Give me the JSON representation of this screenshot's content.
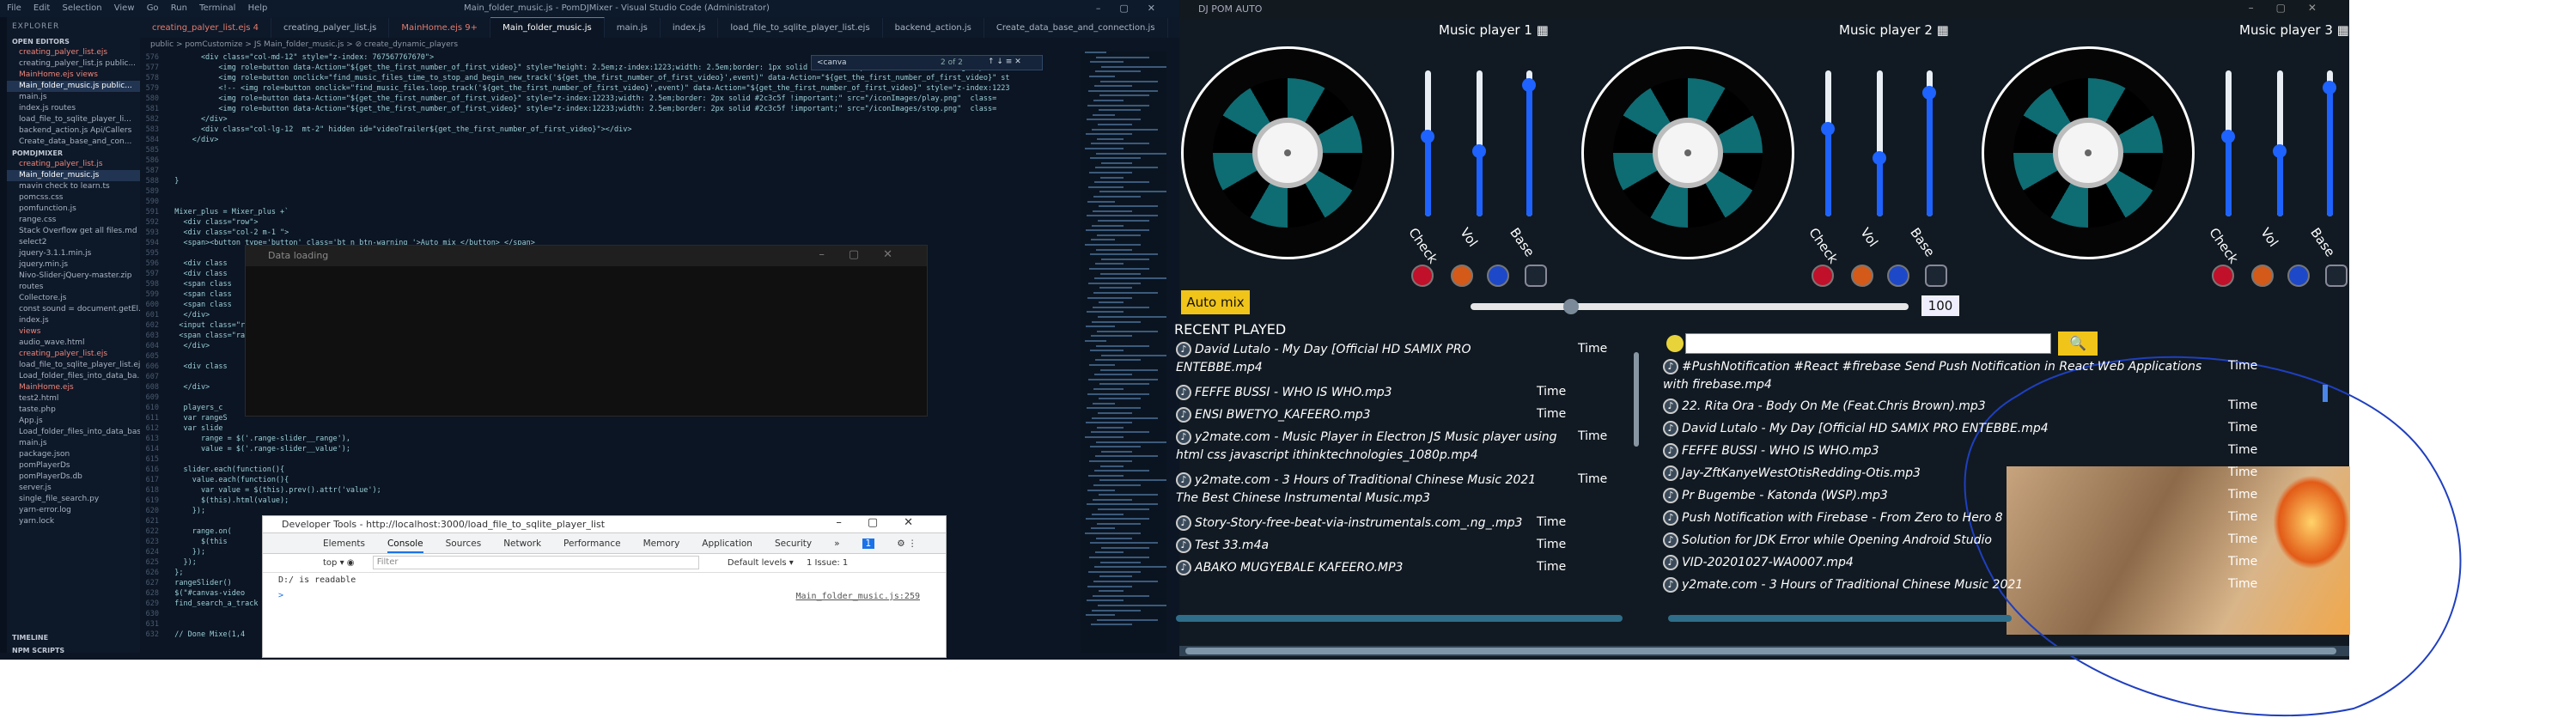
{
  "vscode": {
    "title": "Main_folder_music.js - PomDJMixer - Visual Studio Code (Administrator)",
    "menu": [
      "File",
      "Edit",
      "Selection",
      "View",
      "Go",
      "Run",
      "Terminal",
      "Help"
    ],
    "explorer_title": "EXPLORER",
    "open_editors": "OPEN EDITORS",
    "open_items": [
      "creating_palyer_list.ejs",
      "creating_palyer_list.js public...",
      "MainHome.ejs views",
      "Main_folder_music.js public...",
      "main.js",
      "index.js routes",
      "load_file_to_sqlite_player_li...",
      "backend_action.js Api/Callers",
      "Create_data_base_and_con..."
    ],
    "project": "POMDJMIXER",
    "files": [
      "creating_palyer_list.js",
      "Main_folder_music.js",
      "mavin check to learn.ts",
      "pomcss.css",
      "pomfunction.js",
      "range.css",
      "Stack Overflow get all files.md",
      "select2",
      "jquery-3.1.1.min.js",
      "jquery.min.js",
      "Nivo-Slider-jQuery-master.zip",
      "routes",
      "Collectore.js",
      "const sound = document.getEl...",
      "index.js",
      "views",
      "audio_wave.html",
      "creating_palyer_list.ejs",
      "load_file_to_sqlite_player_list.ejs",
      "Load_folder_files_into_data_ba...",
      "MainHome.ejs",
      "test2.html",
      "taste.php",
      "App.js",
      "Load_folder_files_into_data_base...",
      "main.js",
      "package.json",
      "pomPlayerDs",
      "pomPlayerDs.db",
      "server.js",
      "single_file_search.py",
      "yarn-error.log",
      "yarn.lock"
    ],
    "timeline": "TIMELINE",
    "npm": "NPM SCRIPTS",
    "tabs": [
      "creating_palyer_list.ejs 4",
      "creating_palyer_list.js",
      "MainHome.ejs 9+",
      "Main_folder_music.js",
      "main.js",
      "index.js",
      "load_file_to_sqlite_player_list.ejs",
      "backend_action.js",
      "Create_data_base_and_connection.js"
    ],
    "breadcrumb": "public > pomCustomize > JS Main_folder_music.js > ⊘ create_dynamic_players",
    "find_value": "<canva",
    "find_count": "2 of 2",
    "code": [
      [
        "576",
        "        <div class=\"col-md-12\" style=\"z-index: 767567767670\">"
      ],
      [
        "577",
        "            <img role=button data-Action=\"${get_the_first_number_of_first_video}\" style=\"height: 2.5em;z-index:1223;width: 2.5em;border: 1px solid #2c3c5f !important;\" src=\"/iconImages/pres"
      ],
      [
        "578",
        "            <img role=button onclick=\"find_music_files_time_to_stop_and_begin_new_track('${get_the_first_number_of_first_video}',event)\" data-Action=\"${get_the_first_number_of_first_video}\" st"
      ],
      [
        "579",
        "            <!-- <img role=button onclick=\"find_music_files.loop_track('${get_the_first_number_of_first_video}',event)\" data-Action=\"${get_the_first_number_of_first_video}\" style=\"z-index:1223"
      ],
      [
        "580",
        "            <img role=button data-Action=\"${get_the_first_number_of_first_video}\" style=\"z-index:12233;width: 2.5em;border: 2px solid #2c3c5f !important;\" src=\"/iconImages/play.png\"  class="
      ],
      [
        "581",
        "            <img role=button data-Action=\"${get_the_first_number_of_first_video}\" style=\"z-index:12233;width: 2.5em;border: 2px solid #2c3c5f !important;\" src=\"/iconImages/stop.png\"  class="
      ],
      [
        "582",
        "        </div>"
      ],
      [
        "583",
        "        <div class=\"col-lg-12  mt-2\" hidden id=\"videoTrailer${get_the_first_number_of_first_video}\"></div>"
      ],
      [
        "584",
        "      </div>"
      ],
      [
        "585",
        ""
      ],
      [
        "586",
        ""
      ],
      [
        "587",
        ""
      ],
      [
        "588",
        "  }"
      ],
      [
        "589",
        ""
      ],
      [
        "590",
        ""
      ],
      [
        "591",
        "  Mixer_plus = Mixer_plus +`"
      ],
      [
        "592",
        "    <div class=\"row\">"
      ],
      [
        "593",
        "    <div class=\"col-2 m-1 \">"
      ],
      [
        "594",
        "    <span><button type='button' class='bt n btn-warning '>Auto mix </button> </span>"
      ],
      [
        "595",
        ""
      ],
      [
        "596",
        "    <div class"
      ],
      [
        "597",
        "    <div class"
      ],
      [
        "598",
        "    <span class"
      ],
      [
        "599",
        "    <span class"
      ],
      [
        "600",
        "    <span class"
      ],
      [
        "601",
        "    </div>"
      ],
      [
        "602",
        "   <input class=\"ra"
      ],
      [
        "603",
        "   <span class=\"ra"
      ],
      [
        "604",
        "    </div>"
      ],
      [
        "605",
        ""
      ],
      [
        "606",
        "    <div class"
      ],
      [
        "607",
        "      "
      ],
      [
        "608",
        "    </div>"
      ],
      [
        "609",
        ""
      ],
      [
        "610",
        "    players_c"
      ],
      [
        "611",
        "    var rangeS"
      ],
      [
        "612",
        "    var slide"
      ],
      [
        "613",
        "        range = $('.range-slider__range'),"
      ],
      [
        "614",
        "        value = $('.range-slider__value');"
      ],
      [
        "615",
        ""
      ],
      [
        "616",
        "    slider.each(function(){"
      ],
      [
        "617",
        "      value.each(function(){"
      ],
      [
        "618",
        "        var value = $(this).prev().attr('value');"
      ],
      [
        "619",
        "        $(this).html(value);"
      ],
      [
        "620",
        "      });"
      ],
      [
        "621",
        ""
      ],
      [
        "622",
        "      range.on("
      ],
      [
        "623",
        "        $(this"
      ],
      [
        "624",
        "      });"
      ],
      [
        "625",
        "    });"
      ],
      [
        "626",
        "  };"
      ],
      [
        "627",
        "  rangeSlider()"
      ],
      [
        "628",
        "  $(\"#canvas-video"
      ],
      [
        "629",
        "  find_search_a_track"
      ],
      [
        "630",
        ""
      ],
      [
        "631",
        ""
      ],
      [
        "632",
        "  // Done Mixe(1,4"
      ]
    ],
    "data_loading_title": "Data loading",
    "devtools": {
      "title": "Developer Tools - http://localhost:3000/load_file_to_sqlite_player_list",
      "tabs": [
        "Elements",
        "Console",
        "Sources",
        "Network",
        "Performance",
        "Memory",
        "Application",
        "Security",
        "»"
      ],
      "badge": "1",
      "context": "top",
      "filter_placeholder": "Filter",
      "levels": "Default levels ▾",
      "issues": "1 Issue: 1",
      "log": "D:/ is readable",
      "log_src": "Main_folder_music.js:259",
      "prompt": ">"
    }
  },
  "dj": {
    "title": "DJ POM AUTO",
    "players": [
      "Music player 1",
      "Music player 2",
      "Music player 3"
    ],
    "slider_labels": [
      "Check",
      "Vol",
      "Base"
    ],
    "auto_mix": "Auto mix",
    "master_value": "100",
    "recent_header": "RECENT PLAYED",
    "time_label": "Time",
    "recent": [
      {
        "t": "David Lutalo - My Day [Official HD SAMIX PRO",
        "t2": "ENTEBBE.mp4",
        "italic": true
      },
      {
        "t": "FEFFE BUSSI - WHO IS WHO.mp3",
        "italic": true
      },
      {
        "t": "ENSI BWETYO_KAFEERO.mp3",
        "italic": true
      },
      {
        "t": "y2mate.com - Music Player in Electron JS Music player using",
        "t2": "html css javascript ithinktechnologies_1080p.mp4",
        "italic": true
      },
      {
        "t": "y2mate.com - 3 Hours of Traditional Chinese Music 2021",
        "t2": "The Best Chinese Instrumental Music.mp3",
        "italic": true
      },
      {
        "t": "Story-Story-free-beat-via-instrumentals.com_.ng_.mp3",
        "italic": true
      },
      {
        "t": "Test 33.m4a",
        "italic": true
      },
      {
        "t": "ABAKO MUGYEBALE KAFEERO.MP3",
        "italic": true
      }
    ],
    "search_button": "🔍",
    "results": [
      {
        "t": "#PushNotification #React #firebase Send Push Notification in React Web Applications",
        "t2": "with firebase.mp4"
      },
      {
        "t": "22. Rita Ora - Body On Me (Feat.Chris Brown).mp3"
      },
      {
        "t": "David Lutalo - My Day [Official HD SAMIX PRO ENTEBBE.mp4"
      },
      {
        "t": "FEFFE BUSSI - WHO IS WHO.mp3"
      },
      {
        "t": "Jay-ZftKanyeWestOtisRedding-Otis.mp3"
      },
      {
        "t": "Pr Bugembe - Katonda (WSP).mp3"
      },
      {
        "t": "Push Notification with Firebase - From Zero to Hero 8"
      },
      {
        "t": "Solution for JDK Error while Opening Android Studio"
      },
      {
        "t": "VID-20201027-WA0007.mp4"
      },
      {
        "t": "y2mate.com - 3 Hours of Traditional Chinese Music 2021"
      }
    ],
    "master_level": 0.23,
    "slider_levels": [
      [
        0.55,
        0.45,
        0.9
      ],
      [
        0.6,
        0.4,
        0.85
      ],
      [
        0.55,
        0.45,
        0.88
      ]
    ]
  }
}
